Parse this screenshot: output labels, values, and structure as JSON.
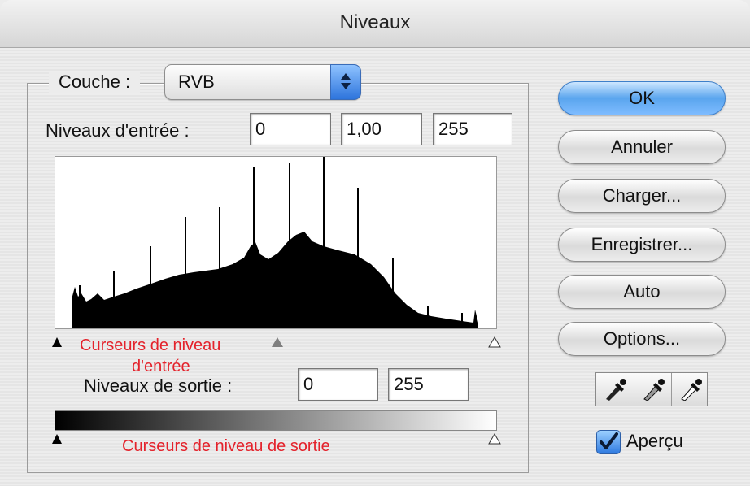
{
  "window": {
    "title": "Niveaux"
  },
  "channel": {
    "label": "Couche :",
    "value": "RVB"
  },
  "input_levels": {
    "label": "Niveaux d'entrée :",
    "black": "0",
    "gamma": "1,00",
    "white": "255"
  },
  "output_levels": {
    "label": "Niveaux de sortie :",
    "black": "0",
    "white": "255"
  },
  "annotations": {
    "input_sliders_line1": "Curseurs de niveau",
    "input_sliders_line2": "d'entrée",
    "output_sliders": "Curseurs de niveau de sortie",
    "color": "#e4222b"
  },
  "buttons": {
    "ok": "OK",
    "cancel": "Annuler",
    "load": "Charger...",
    "save": "Enregistrer...",
    "auto": "Auto",
    "options": "Options..."
  },
  "eyedroppers": [
    "black-point-eyedropper-icon",
    "gray-point-eyedropper-icon",
    "white-point-eyedropper-icon"
  ],
  "preview": {
    "label": "Aperçu",
    "checked": true
  },
  "colors": {
    "accent": "#4a96e8",
    "histogram": "#000000"
  }
}
